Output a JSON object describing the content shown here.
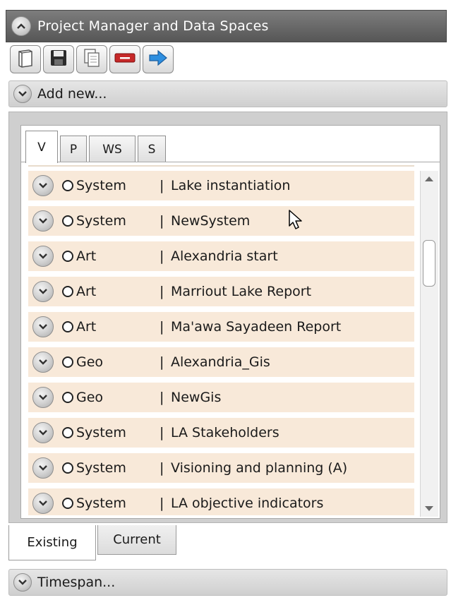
{
  "header": {
    "title": "Project Manager and Data Spaces"
  },
  "toolbar": {
    "buttons": [
      {
        "icon": "open-book-icon"
      },
      {
        "icon": "save-icon"
      },
      {
        "icon": "copy-icon"
      },
      {
        "icon": "remove-icon"
      },
      {
        "icon": "arrow-right-icon"
      }
    ]
  },
  "add_new": {
    "label": "Add new..."
  },
  "tabs": [
    "V",
    "P",
    "WS",
    "S"
  ],
  "active_tab": "V",
  "rows": [
    {
      "category": "System",
      "separator": "|",
      "name": "Lake instantiation"
    },
    {
      "category": "System",
      "separator": "|",
      "name": "NewSystem"
    },
    {
      "category": "Art",
      "separator": "|",
      "name": "Alexandria start"
    },
    {
      "category": "Art",
      "separator": "|",
      "name": "Marriout Lake Report"
    },
    {
      "category": "Art",
      "separator": "|",
      "name": "Ma'awa Sayadeen Report"
    },
    {
      "category": "Geo",
      "separator": "|",
      "name": "Alexandria_Gis"
    },
    {
      "category": "Geo",
      "separator": "|",
      "name": "NewGis"
    },
    {
      "category": "System",
      "separator": "|",
      "name": "LA Stakeholders"
    },
    {
      "category": "System",
      "separator": "|",
      "name": "Visioning and planning (A)"
    },
    {
      "category": "System",
      "separator": "|",
      "name": "LA objective indicators"
    }
  ],
  "bottom_tabs": [
    "Existing",
    "Current"
  ],
  "active_bottom_tab": "Existing",
  "timespan": {
    "label": "Timespan..."
  },
  "colors": {
    "row_bg": "#f8e9d9",
    "header_bg": "#666666"
  }
}
